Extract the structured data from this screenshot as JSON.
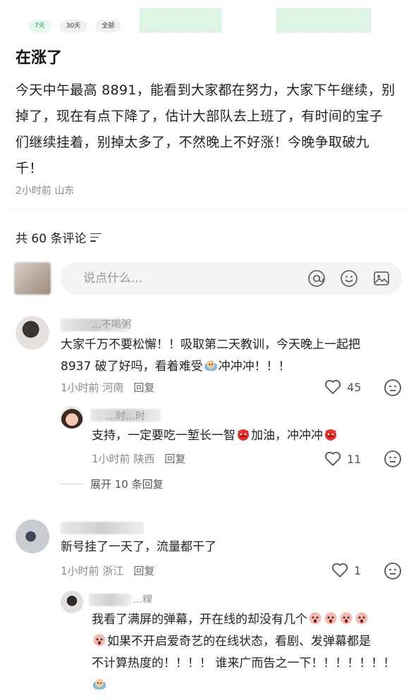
{
  "filters": {
    "seven_days": "7天",
    "thirty_days": "30天",
    "all": "全部"
  },
  "post": {
    "title": "在涨了",
    "body": "今天中午最高 8891，能看到大家都在努力，大家下午继续，别掉了，现在有点下降了，估计大部队去上班了，有时间的宝子们继续挂着，别掉太多了，不然晚上不好涨！今晚争取破九千！",
    "time": "2小时前",
    "location": "山东"
  },
  "comments_header": {
    "count_label": "共 60 条评论"
  },
  "input": {
    "placeholder": "说点什么..."
  },
  "comments": [
    {
      "name_partial": "…不喝粥",
      "text_a": "大家千万不要松懈！！吸取第二天教训，今天晚上一起把",
      "text_b": "8937 破了好吗，看着难受",
      "text_c": "冲冲冲！！！",
      "time": "1小时前",
      "location": "河南",
      "reply": "回复",
      "likes": "45"
    },
    {
      "name_partial": "…时…时",
      "text_a": "支持，一定要吃一堑长一智",
      "text_b": "加油，冲冲冲",
      "time": "1小时前",
      "location": "陕西",
      "reply": "回复",
      "likes": "11"
    },
    {
      "text": "新号挂了一天了，流量都干了",
      "time": "1小时前",
      "location": "浙江",
      "reply": "回复",
      "likes": "1"
    },
    {
      "name_partial": "…粿",
      "line1": "我看了满屏的弹幕，开在线的却没有几个",
      "line2": "如果不开启爱奇艺的在线状态，看剧、发弹幕都是",
      "line3": "不计算热度的！！！！ 谁来广而告之一下！！！！！！！"
    }
  ],
  "expand_label": "展开 10 条回复"
}
